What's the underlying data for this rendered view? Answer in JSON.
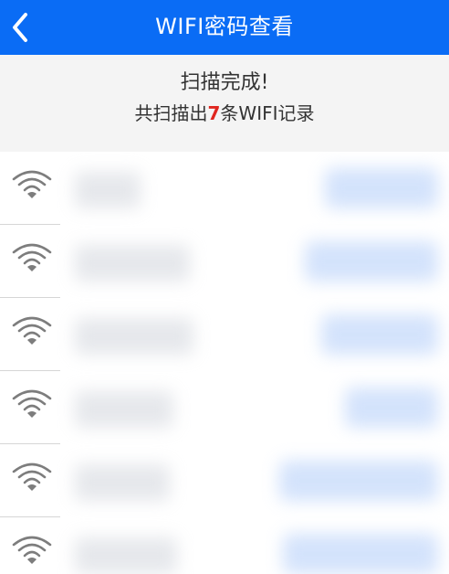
{
  "header": {
    "title": "WIFI密码查看",
    "back_icon": "chevron-left-icon",
    "color": "#0a6cf5"
  },
  "summary": {
    "status": "扫描完成!",
    "prefix": "共扫描出",
    "count": "7",
    "suffix": "条WIFI记录",
    "count_color": "#e0261f"
  },
  "list": {
    "item_icon": "wifi-icon",
    "visible_rows": 6
  }
}
